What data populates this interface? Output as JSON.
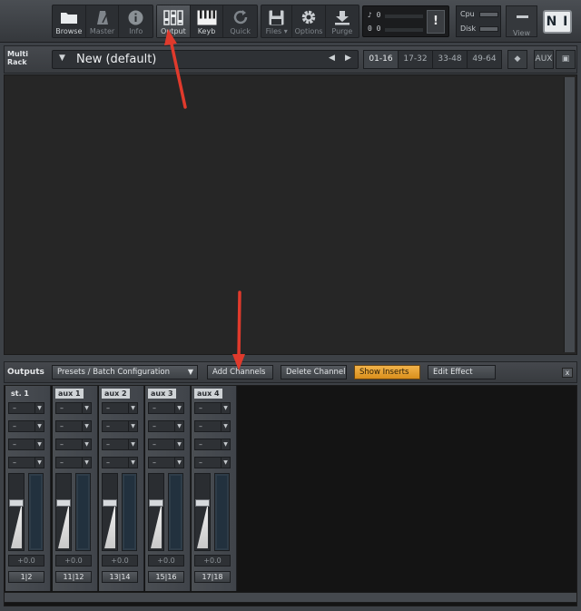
{
  "toolbar": {
    "buttons": [
      {
        "label": "Browse",
        "icon": "folder-icon"
      },
      {
        "label": "Master",
        "icon": "metronome-icon"
      },
      {
        "label": "Info",
        "icon": "info-icon"
      },
      {
        "label": "Output",
        "icon": "faders-icon"
      },
      {
        "label": "Keyb",
        "icon": "keyboard-icon"
      },
      {
        "label": "Quick",
        "icon": "refresh-icon"
      },
      {
        "label": "Files",
        "icon": "disk-icon"
      },
      {
        "label": "Options",
        "icon": "gear-icon"
      },
      {
        "label": "Purge",
        "icon": "purge-icon"
      }
    ],
    "display": {
      "voices": "0",
      "memory": "0 0",
      "alert": "!"
    },
    "cpu_label": "Cpu",
    "disk_label": "Disk",
    "view_label": "View",
    "logo": "N I"
  },
  "rack": {
    "title": "Multi Rack",
    "preset_name": "New (default)",
    "pages": [
      "01-16",
      "17-32",
      "33-48",
      "49-64"
    ],
    "selected_page": "01-16",
    "aux_label": "AUX"
  },
  "outputs": {
    "title": "Outputs",
    "preset_dropdown": "Presets / Batch Configuration",
    "add_channels": "Add Channels",
    "delete_channel": "Delete Channel",
    "show_inserts": "Show Inserts",
    "edit_effect": "Edit Effect",
    "close": "x",
    "channels": [
      {
        "name": "st. 1",
        "volume": "+0.0",
        "route": "1|2"
      },
      {
        "name": "aux 1",
        "volume": "+0.0",
        "route": "11|12"
      },
      {
        "name": "aux 2",
        "volume": "+0.0",
        "route": "13|14"
      },
      {
        "name": "aux 3",
        "volume": "+0.0",
        "route": "15|16"
      },
      {
        "name": "aux 4",
        "volume": "+0.0",
        "route": "17|18"
      }
    ],
    "slot_value": "–"
  },
  "colors": {
    "accent_orange": "#e8a030",
    "annotation_arrow": "#e03a2c"
  }
}
